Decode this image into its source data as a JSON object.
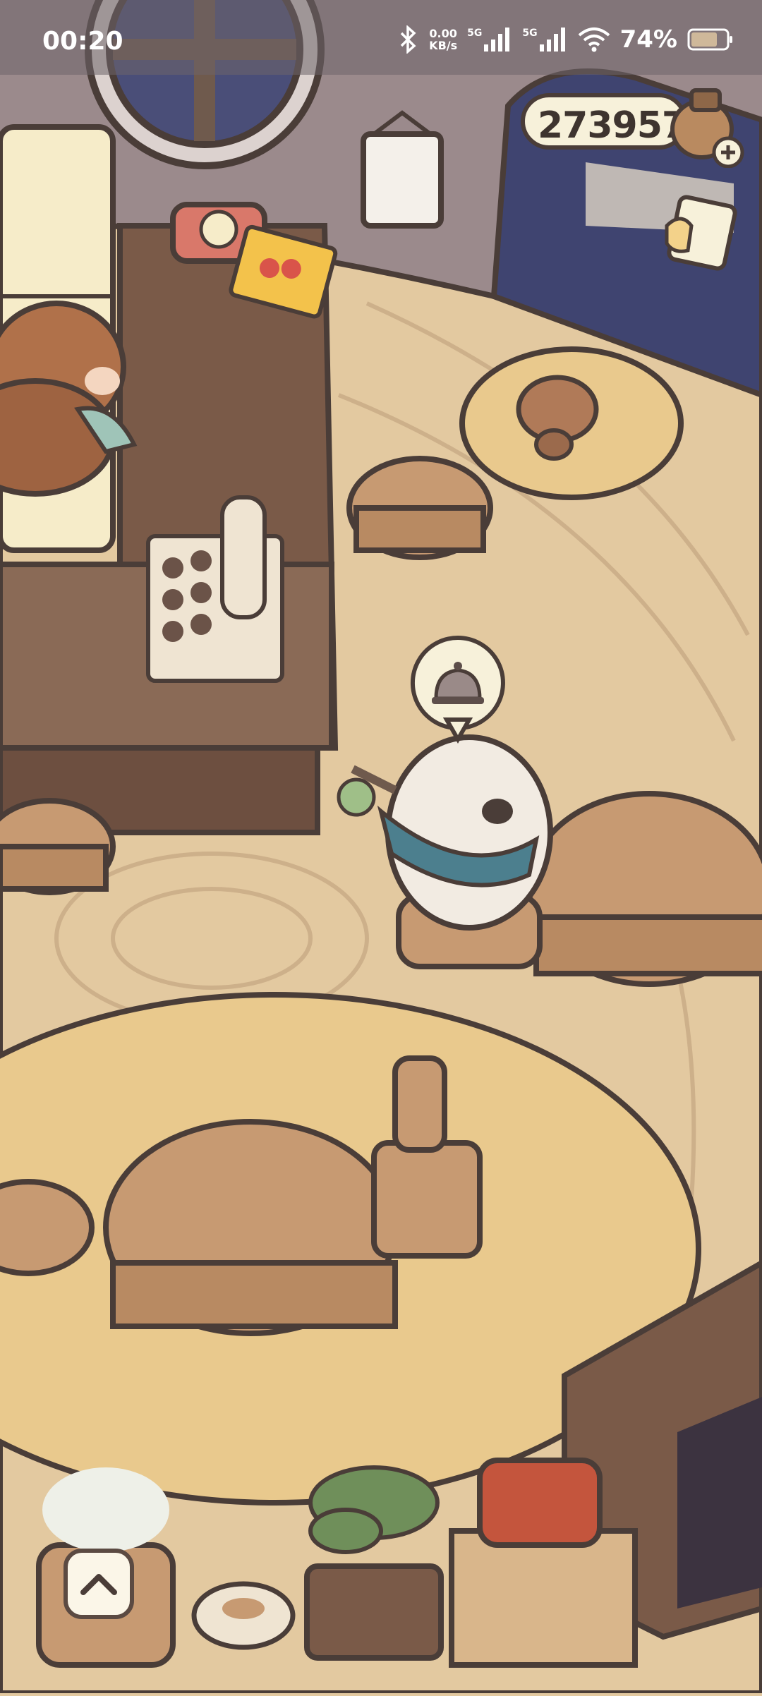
{
  "status_bar": {
    "time": "00:20",
    "net_speed_value": "0.00",
    "net_speed_unit": "KB/s",
    "sim1_label": "5G",
    "sim2_label": "5G",
    "battery_percent": "74%"
  },
  "hud": {
    "coins": "273957"
  },
  "icons": {
    "bluetooth": "bluetooth-icon",
    "signal": "signal-icon",
    "wifi": "wifi-icon",
    "battery": "battery-icon",
    "coin_add": "plus-icon",
    "expand": "chevron-up-icon",
    "service_bell": "service-bell-icon"
  },
  "colors": {
    "floor": "#e3c9a0",
    "wall": "#9b8a8c",
    "wood_dark": "#7a5a48",
    "outline": "#4a3d38"
  }
}
